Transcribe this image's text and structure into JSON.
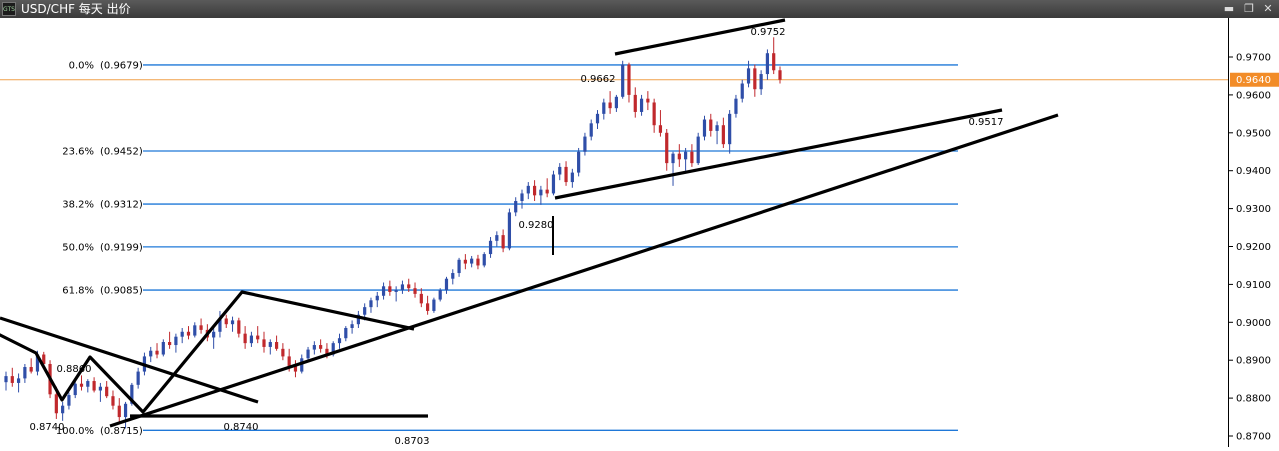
{
  "window": {
    "title": "USD/CHF 每天 出价",
    "app_icon_text": "GTS",
    "minimize_glyph": "▬",
    "restore_glyph": "❐",
    "close_glyph": "✕"
  },
  "chart_data": {
    "type": "candlestick",
    "symbol": "USD/CHF",
    "timeframe": "每天",
    "price_type": "出价",
    "ylim": [
      0.869,
      0.978
    ],
    "y_ticks": [
      "0.9700",
      "0.9600",
      "0.9500",
      "0.9400",
      "0.9300",
      "0.9200",
      "0.9100",
      "0.9000",
      "0.8900",
      "0.8800",
      "0.8700"
    ],
    "current_price": {
      "value": 0.964,
      "label": "0.9640"
    },
    "fibonacci_levels": [
      {
        "label": "0.0%",
        "value_label": "(0.9679)",
        "price": 0.9679
      },
      {
        "label": "23.6%",
        "value_label": "(0.9452)",
        "price": 0.9452
      },
      {
        "label": "38.2%",
        "value_label": "(0.9312)",
        "price": 0.9312
      },
      {
        "label": "50.0%",
        "value_label": "(0.9199)",
        "price": 0.9199
      },
      {
        "label": "61.8%",
        "value_label": "(0.9085)",
        "price": 0.9085
      },
      {
        "label": "100.0%",
        "value_label": "(0.8715)",
        "price": 0.8715
      }
    ],
    "annotations": [
      {
        "text": "0.9752",
        "price": 0.9752
      },
      {
        "text": "0.9662",
        "price": 0.9662
      },
      {
        "text": "0.9517",
        "price": 0.9517
      },
      {
        "text": "0.9280",
        "price": 0.928
      },
      {
        "text": "0.8860",
        "price": 0.886
      },
      {
        "text": "0.8740",
        "price": 0.874
      },
      {
        "text": "0.8740",
        "price": 0.874
      },
      {
        "text": "0.8703",
        "price": 0.8703
      }
    ],
    "colors": {
      "bull": "#2f4ea8",
      "bear": "#c0282c",
      "fib_line": "#1f78d8",
      "current_price_line": "#f0a04a",
      "current_price_label_bg": "#f28c28",
      "trend_line": "#000000"
    },
    "candles": [
      [
        0.8842,
        0.887,
        0.882,
        0.8858
      ],
      [
        0.8858,
        0.888,
        0.883,
        0.884
      ],
      [
        0.884,
        0.8865,
        0.8815,
        0.8852
      ],
      [
        0.8852,
        0.889,
        0.884,
        0.8882
      ],
      [
        0.8882,
        0.8905,
        0.8865,
        0.887
      ],
      [
        0.887,
        0.8925,
        0.886,
        0.8915
      ],
      [
        0.8915,
        0.8922,
        0.888,
        0.889
      ],
      [
        0.889,
        0.89,
        0.88,
        0.881
      ],
      [
        0.881,
        0.883,
        0.8745,
        0.876
      ],
      [
        0.876,
        0.879,
        0.874,
        0.878
      ],
      [
        0.878,
        0.8815,
        0.877,
        0.8808
      ],
      [
        0.8808,
        0.8845,
        0.88,
        0.8838
      ],
      [
        0.8838,
        0.886,
        0.882,
        0.883
      ],
      [
        0.883,
        0.885,
        0.8815,
        0.8845
      ],
      [
        0.8845,
        0.8855,
        0.8815,
        0.882
      ],
      [
        0.882,
        0.884,
        0.879,
        0.883
      ],
      [
        0.883,
        0.8845,
        0.88,
        0.8805
      ],
      [
        0.8805,
        0.882,
        0.877,
        0.878
      ],
      [
        0.878,
        0.88,
        0.8735,
        0.875
      ],
      [
        0.875,
        0.879,
        0.872,
        0.8785
      ],
      [
        0.8785,
        0.884,
        0.878,
        0.8835
      ],
      [
        0.8835,
        0.888,
        0.8825,
        0.887
      ],
      [
        0.887,
        0.892,
        0.886,
        0.891
      ],
      [
        0.891,
        0.8935,
        0.8895,
        0.8925
      ],
      [
        0.8925,
        0.8945,
        0.8905,
        0.8915
      ],
      [
        0.8915,
        0.8955,
        0.891,
        0.8948
      ],
      [
        0.8948,
        0.8975,
        0.893,
        0.894
      ],
      [
        0.894,
        0.897,
        0.892,
        0.8962
      ],
      [
        0.8962,
        0.8985,
        0.8945,
        0.8975
      ],
      [
        0.8975,
        0.899,
        0.8955,
        0.8965
      ],
      [
        0.8965,
        0.9,
        0.896,
        0.8992
      ],
      [
        0.8992,
        0.901,
        0.897,
        0.898
      ],
      [
        0.898,
        0.8995,
        0.895,
        0.896
      ],
      [
        0.896,
        0.8985,
        0.893,
        0.8975
      ],
      [
        0.8975,
        0.903,
        0.896,
        0.901
      ],
      [
        0.901,
        0.902,
        0.8985,
        0.8995
      ],
      [
        0.8995,
        0.9015,
        0.8975,
        0.9005
      ],
      [
        0.9005,
        0.9012,
        0.896,
        0.897
      ],
      [
        0.897,
        0.899,
        0.893,
        0.8945
      ],
      [
        0.8945,
        0.8975,
        0.8935,
        0.8965
      ],
      [
        0.8965,
        0.899,
        0.8945,
        0.8955
      ],
      [
        0.8955,
        0.8975,
        0.892,
        0.8935
      ],
      [
        0.8935,
        0.8955,
        0.8915,
        0.8948
      ],
      [
        0.8948,
        0.8965,
        0.8925,
        0.893
      ],
      [
        0.893,
        0.8945,
        0.89,
        0.891
      ],
      [
        0.891,
        0.893,
        0.887,
        0.8885
      ],
      [
        0.8885,
        0.89,
        0.8855,
        0.887
      ],
      [
        0.887,
        0.8915,
        0.8865,
        0.8905
      ],
      [
        0.8905,
        0.8935,
        0.8895,
        0.8928
      ],
      [
        0.8928,
        0.895,
        0.8915,
        0.894
      ],
      [
        0.894,
        0.8955,
        0.892,
        0.893
      ],
      [
        0.893,
        0.8945,
        0.8905,
        0.8915
      ],
      [
        0.8915,
        0.895,
        0.891,
        0.8945
      ],
      [
        0.8945,
        0.897,
        0.893,
        0.8958
      ],
      [
        0.8958,
        0.899,
        0.895,
        0.8985
      ],
      [
        0.8985,
        0.9005,
        0.897,
        0.8995
      ],
      [
        0.8995,
        0.903,
        0.8985,
        0.902
      ],
      [
        0.902,
        0.905,
        0.9005,
        0.904
      ],
      [
        0.904,
        0.9065,
        0.9025,
        0.9058
      ],
      [
        0.9058,
        0.908,
        0.904,
        0.907
      ],
      [
        0.907,
        0.9105,
        0.906,
        0.9095
      ],
      [
        0.9095,
        0.911,
        0.907,
        0.908
      ],
      [
        0.908,
        0.9095,
        0.9055,
        0.9085
      ],
      [
        0.9085,
        0.911,
        0.9075,
        0.91
      ],
      [
        0.91,
        0.9115,
        0.908,
        0.909
      ],
      [
        0.909,
        0.9105,
        0.9065,
        0.9075
      ],
      [
        0.9075,
        0.909,
        0.904,
        0.905
      ],
      [
        0.905,
        0.907,
        0.902,
        0.903
      ],
      [
        0.903,
        0.9065,
        0.9025,
        0.906
      ],
      [
        0.906,
        0.909,
        0.9055,
        0.9085
      ],
      [
        0.9085,
        0.912,
        0.9075,
        0.9115
      ],
      [
        0.9115,
        0.914,
        0.91,
        0.913
      ],
      [
        0.913,
        0.917,
        0.912,
        0.9165
      ],
      [
        0.9165,
        0.918,
        0.914,
        0.9155
      ],
      [
        0.9155,
        0.9175,
        0.9145,
        0.9168
      ],
      [
        0.9168,
        0.9178,
        0.914,
        0.915
      ],
      [
        0.915,
        0.9185,
        0.9145,
        0.918
      ],
      [
        0.918,
        0.9225,
        0.917,
        0.9215
      ],
      [
        0.9215,
        0.924,
        0.92,
        0.923
      ],
      [
        0.923,
        0.9245,
        0.9185,
        0.9195
      ],
      [
        0.9195,
        0.93,
        0.919,
        0.929
      ],
      [
        0.929,
        0.933,
        0.928,
        0.932
      ],
      [
        0.932,
        0.935,
        0.93,
        0.934
      ],
      [
        0.934,
        0.937,
        0.9325,
        0.936
      ],
      [
        0.936,
        0.9375,
        0.932,
        0.9335
      ],
      [
        0.9335,
        0.936,
        0.931,
        0.935
      ],
      [
        0.935,
        0.938,
        0.933,
        0.934
      ],
      [
        0.934,
        0.94,
        0.9335,
        0.939
      ],
      [
        0.939,
        0.942,
        0.9375,
        0.941
      ],
      [
        0.941,
        0.9425,
        0.936,
        0.937
      ],
      [
        0.937,
        0.9405,
        0.9355,
        0.9395
      ],
      [
        0.9395,
        0.946,
        0.9385,
        0.945
      ],
      [
        0.945,
        0.95,
        0.944,
        0.949
      ],
      [
        0.949,
        0.9535,
        0.948,
        0.9525
      ],
      [
        0.9525,
        0.956,
        0.951,
        0.955
      ],
      [
        0.955,
        0.959,
        0.9535,
        0.958
      ],
      [
        0.958,
        0.961,
        0.955,
        0.9565
      ],
      [
        0.9565,
        0.96,
        0.9555,
        0.9595
      ],
      [
        0.9595,
        0.969,
        0.959,
        0.968
      ],
      [
        0.968,
        0.9685,
        0.958,
        0.96
      ],
      [
        0.96,
        0.962,
        0.954,
        0.9555
      ],
      [
        0.9555,
        0.96,
        0.9545,
        0.959
      ],
      [
        0.959,
        0.961,
        0.956,
        0.958
      ],
      [
        0.958,
        0.959,
        0.95,
        0.952
      ],
      [
        0.952,
        0.956,
        0.949,
        0.95
      ],
      [
        0.95,
        0.951,
        0.94,
        0.942
      ],
      [
        0.942,
        0.945,
        0.936,
        0.9445
      ],
      [
        0.9445,
        0.947,
        0.941,
        0.943
      ],
      [
        0.943,
        0.946,
        0.94,
        0.945
      ],
      [
        0.945,
        0.947,
        0.941,
        0.942
      ],
      [
        0.942,
        0.95,
        0.9415,
        0.949
      ],
      [
        0.949,
        0.9545,
        0.948,
        0.9535
      ],
      [
        0.9535,
        0.955,
        0.949,
        0.9505
      ],
      [
        0.9505,
        0.953,
        0.947,
        0.952
      ],
      [
        0.952,
        0.954,
        0.946,
        0.947
      ],
      [
        0.947,
        0.956,
        0.9445,
        0.955
      ],
      [
        0.955,
        0.96,
        0.954,
        0.959
      ],
      [
        0.959,
        0.964,
        0.958,
        0.963
      ],
      [
        0.963,
        0.969,
        0.962,
        0.967
      ],
      [
        0.967,
        0.968,
        0.9595,
        0.9615
      ],
      [
        0.9615,
        0.9665,
        0.96,
        0.9655
      ],
      [
        0.9655,
        0.972,
        0.964,
        0.971
      ],
      [
        0.971,
        0.9752,
        0.9655,
        0.9665
      ],
      [
        0.9665,
        0.9675,
        0.963,
        0.964
      ]
    ]
  }
}
